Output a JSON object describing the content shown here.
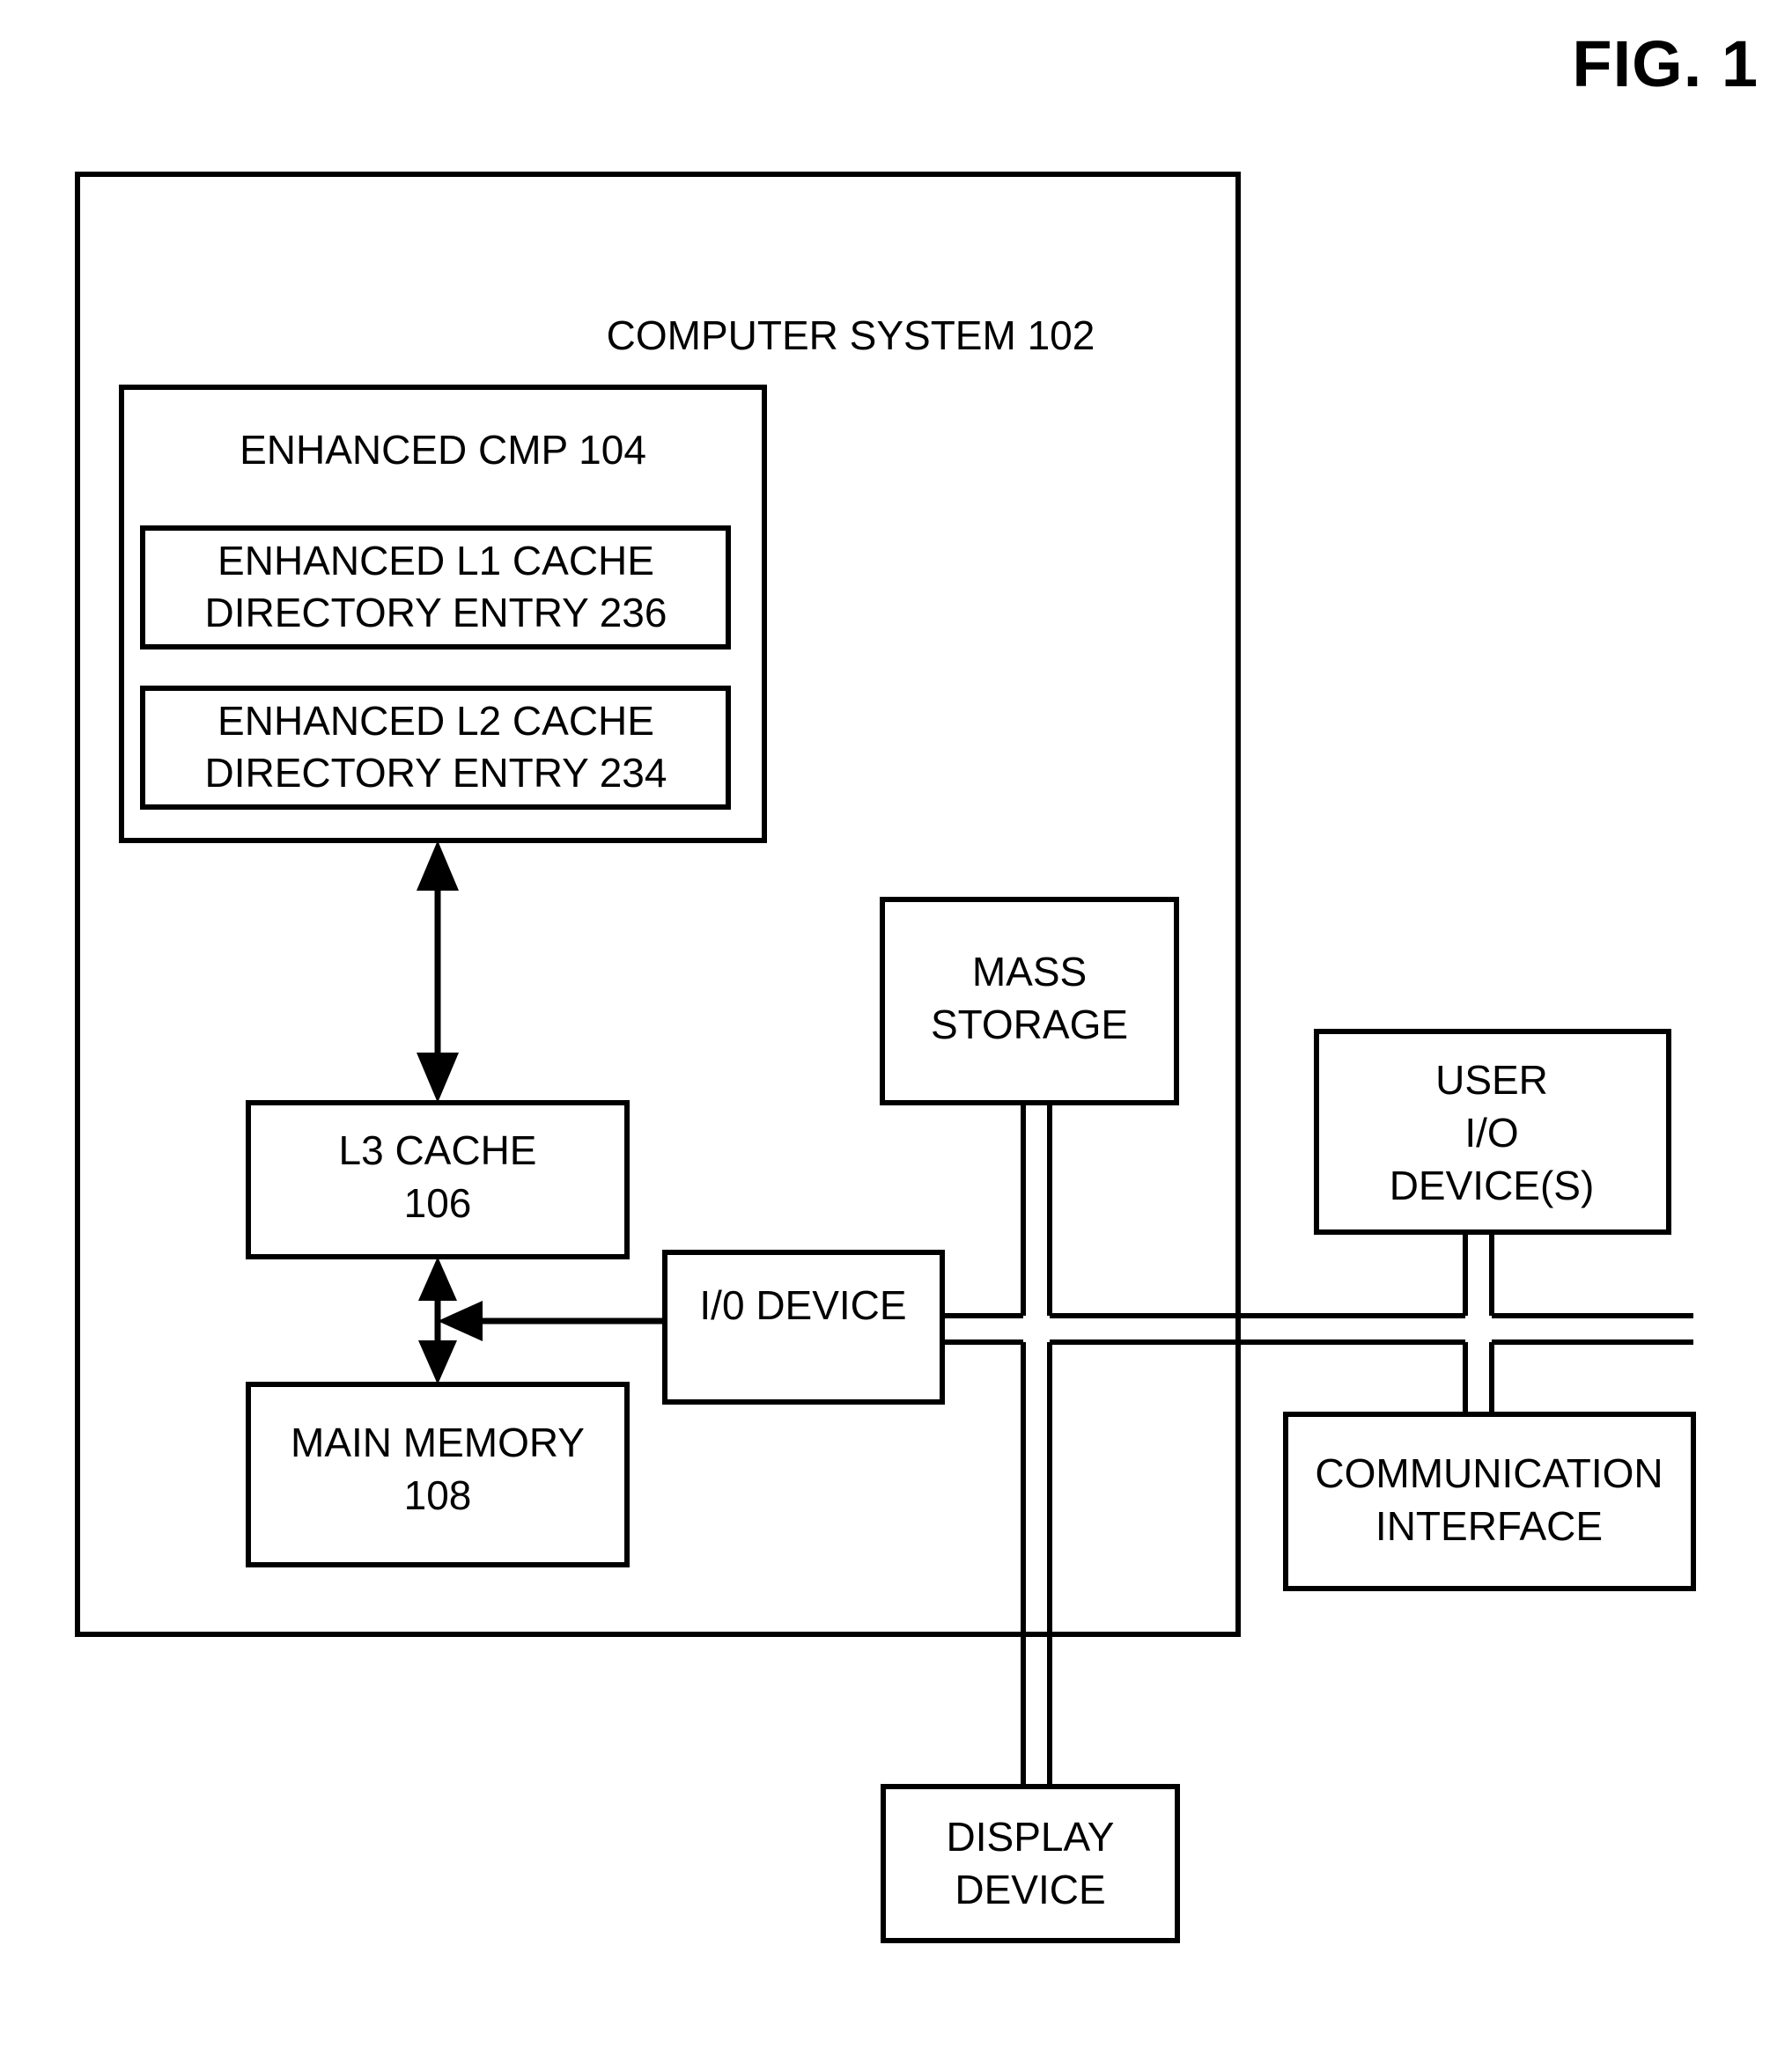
{
  "figure": {
    "title": "FIG. 1",
    "type": "block-diagram",
    "line_color": "#000000",
    "background_color": "#ffffff"
  },
  "blocks": {
    "computer_system": {
      "label": "COMPUTER SYSTEM 102"
    },
    "enhanced_cmp": {
      "label": "ENHANCED CMP 104"
    },
    "l1_entry": {
      "line1": "ENHANCED L1 CACHE",
      "line2": "DIRECTORY ENTRY 236"
    },
    "l2_entry": {
      "line1": "ENHANCED L2 CACHE",
      "line2": "DIRECTORY ENTRY 234"
    },
    "l3_cache": {
      "line1": "L3 CACHE",
      "line2": "106"
    },
    "main_memory": {
      "line1": "MAIN MEMORY",
      "line2": "108"
    },
    "mass_storage": {
      "line1": "MASS",
      "line2": "STORAGE"
    },
    "io_device": {
      "label": "I/0 DEVICE"
    },
    "user_io_devices": {
      "line1": "USER",
      "line2": "I/O",
      "line3": "DEVICE(S)"
    },
    "communication_interface": {
      "line1": "COMMUNICATION",
      "line2": "INTERFACE"
    },
    "display_device": {
      "line1": "DISPLAY",
      "line2": "DEVICE"
    }
  },
  "connectors": [
    {
      "name": "cmp-to-l3-cache",
      "style": "double-headed-arrow",
      "orientation": "vertical"
    },
    {
      "name": "l3-cache-to-main-memory",
      "style": "double-headed-arrow",
      "orientation": "vertical"
    },
    {
      "name": "io-device-to-memory-bus",
      "style": "single-headed-arrow",
      "orientation": "horizontal-left"
    },
    {
      "name": "mass-storage-bus",
      "style": "double-line",
      "orientation": "vertical"
    },
    {
      "name": "display-device-bus",
      "style": "double-line",
      "orientation": "vertical"
    },
    {
      "name": "user-io-bus",
      "style": "double-line",
      "orientation": "vertical"
    },
    {
      "name": "io-bus-upper",
      "style": "line",
      "orientation": "horizontal"
    },
    {
      "name": "io-bus-lower",
      "style": "line",
      "orientation": "horizontal"
    }
  ]
}
